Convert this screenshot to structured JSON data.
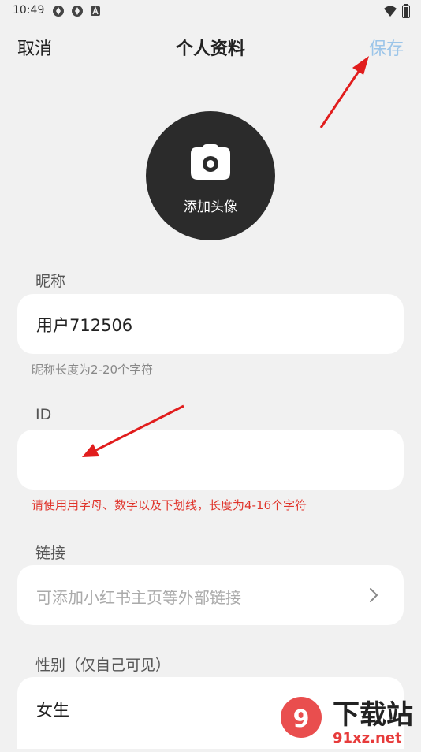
{
  "status": {
    "time": "10:49"
  },
  "nav": {
    "cancel": "取消",
    "title": "个人资料",
    "save": "保存"
  },
  "avatar": {
    "label": "添加头像"
  },
  "nickname": {
    "label": "昵称",
    "value": "用户712506",
    "hint": "昵称长度为2-20个字符"
  },
  "id_field": {
    "label": "ID",
    "value": "",
    "error": "请使用用字母、数字以及下划线，长度为4-16个字符"
  },
  "link": {
    "label": "链接",
    "placeholder": "可添加小红书主页等外部链接"
  },
  "gender": {
    "label": "性别（仅自己可见）",
    "value": "女生"
  },
  "watermark": {
    "text": "下载站",
    "domain": "91xz.net"
  },
  "colors": {
    "annotation_arrow": "#e11d1d",
    "save_disabled": "#9cc5e9",
    "error": "#e0342b"
  }
}
